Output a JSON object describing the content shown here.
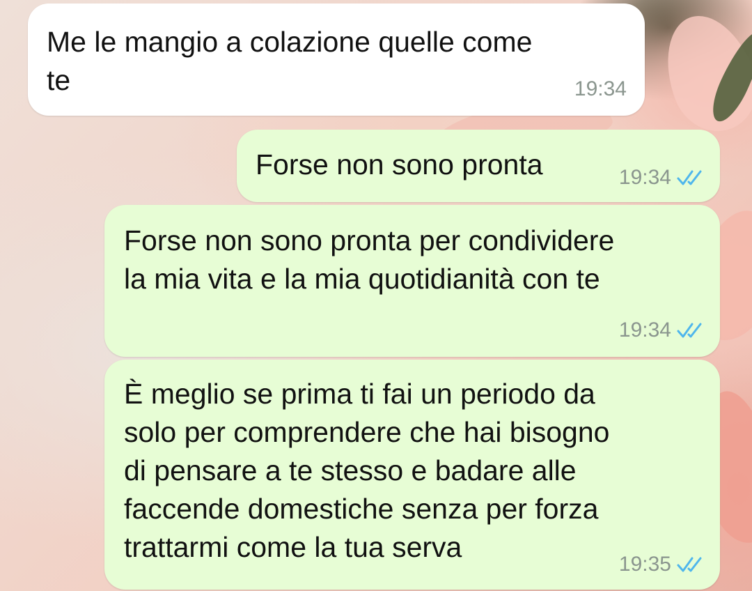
{
  "messages": [
    {
      "direction": "incoming",
      "text": "Me le mangio a colazione quelle come\nte",
      "time": "19:34"
    },
    {
      "direction": "outgoing",
      "text": "Forse non sono pronta",
      "time": "19:34",
      "status": "read",
      "status_icon": "double-check-icon"
    },
    {
      "direction": "outgoing",
      "text": "Forse non sono pronta per condividere\nla mia vita e la mia quotidianità con te",
      "time": "19:34",
      "status": "read",
      "status_icon": "double-check-icon"
    },
    {
      "direction": "outgoing",
      "text": "È meglio se prima ti fai un periodo da\nsolo per comprendere che hai bisogno\ndi pensare a te stesso e badare alle\nfaccende domestiche senza per forza\ntrattarmi come la tua serva",
      "time": "19:35",
      "status": "read",
      "status_icon": "double-check-icon"
    }
  ],
  "colors": {
    "incoming_bubble": "#ffffff",
    "outgoing_bubble": "#e7fdd5",
    "timestamp": "#8a958e",
    "read_ticks": "#4fb6ec"
  }
}
